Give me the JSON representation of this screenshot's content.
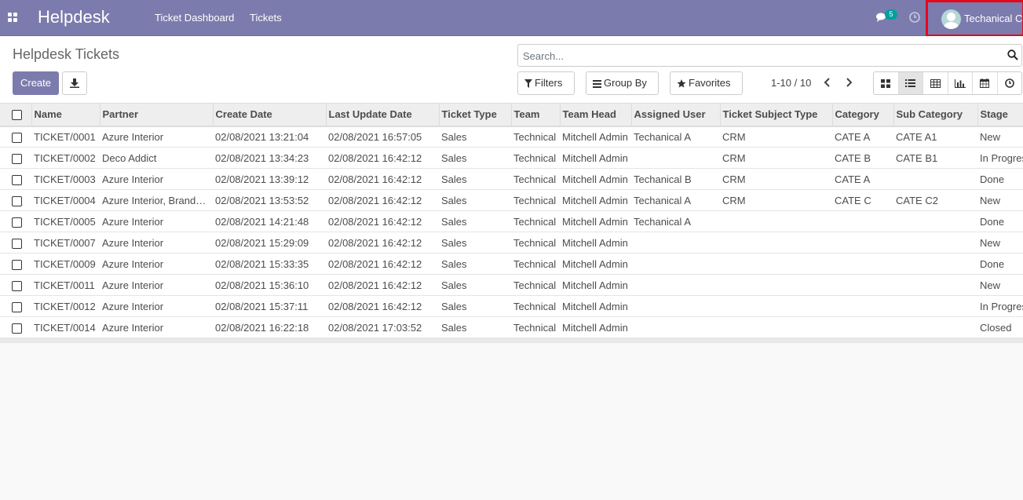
{
  "navbar": {
    "brand": "Helpdesk",
    "menu": [
      "Ticket Dashboard",
      "Tickets"
    ],
    "chat_count": "5",
    "user_name": "Techanical C"
  },
  "control_panel": {
    "title": "Helpdesk Tickets",
    "create_label": "Create",
    "search_placeholder": "Search...",
    "filters_label": "Filters",
    "group_by_label": "Group By",
    "favorites_label": "Favorites",
    "pager": "1-10 / 10"
  },
  "table": {
    "columns": [
      "Name",
      "Partner",
      "Create Date",
      "Last Update Date",
      "Ticket Type",
      "Team",
      "Team Head",
      "Assigned User",
      "Ticket Subject Type",
      "Category",
      "Sub Category",
      "Stage"
    ],
    "rows": [
      [
        "TICKET/0001",
        "Azure Interior",
        "02/08/2021 13:21:04",
        "02/08/2021 16:57:05",
        "Sales",
        "Technical",
        "Mitchell Admin",
        "Techanical A",
        "CRM",
        "CATE A",
        "CATE A1",
        "New"
      ],
      [
        "TICKET/0002",
        "Deco Addict",
        "02/08/2021 13:34:23",
        "02/08/2021 16:42:12",
        "Sales",
        "Technical",
        "Mitchell Admin",
        "",
        "CRM",
        "CATE B",
        "CATE B1",
        "In Progress"
      ],
      [
        "TICKET/0003",
        "Azure Interior",
        "02/08/2021 13:39:12",
        "02/08/2021 16:42:12",
        "Sales",
        "Technical",
        "Mitchell Admin",
        "Techanical B",
        "CRM",
        "CATE A",
        "",
        "Done"
      ],
      [
        "TICKET/0004",
        "Azure Interior, Brandon Freeman",
        "02/08/2021 13:53:52",
        "02/08/2021 16:42:12",
        "Sales",
        "Technical",
        "Mitchell Admin",
        "Techanical A",
        "CRM",
        "CATE C",
        "CATE C2",
        "New"
      ],
      [
        "TICKET/0005",
        "Azure Interior",
        "02/08/2021 14:21:48",
        "02/08/2021 16:42:12",
        "Sales",
        "Technical",
        "Mitchell Admin",
        "Techanical A",
        "",
        "",
        "",
        "Done"
      ],
      [
        "TICKET/0007",
        "Azure Interior",
        "02/08/2021 15:29:09",
        "02/08/2021 16:42:12",
        "Sales",
        "Technical",
        "Mitchell Admin",
        "",
        "",
        "",
        "",
        "New"
      ],
      [
        "TICKET/0009",
        "Azure Interior",
        "02/08/2021 15:33:35",
        "02/08/2021 16:42:12",
        "Sales",
        "Technical",
        "Mitchell Admin",
        "",
        "",
        "",
        "",
        "Done"
      ],
      [
        "TICKET/0011",
        "Azure Interior",
        "02/08/2021 15:36:10",
        "02/08/2021 16:42:12",
        "Sales",
        "Technical",
        "Mitchell Admin",
        "",
        "",
        "",
        "",
        "New"
      ],
      [
        "TICKET/0012",
        "Azure Interior",
        "02/08/2021 15:37:11",
        "02/08/2021 16:42:12",
        "Sales",
        "Technical",
        "Mitchell Admin",
        "",
        "",
        "",
        "",
        "In Progress"
      ],
      [
        "TICKET/0014",
        "Azure Interior",
        "02/08/2021 16:22:18",
        "02/08/2021 17:03:52",
        "Sales",
        "Technical",
        "Mitchell Admin",
        "",
        "",
        "",
        "",
        "Closed"
      ]
    ]
  }
}
